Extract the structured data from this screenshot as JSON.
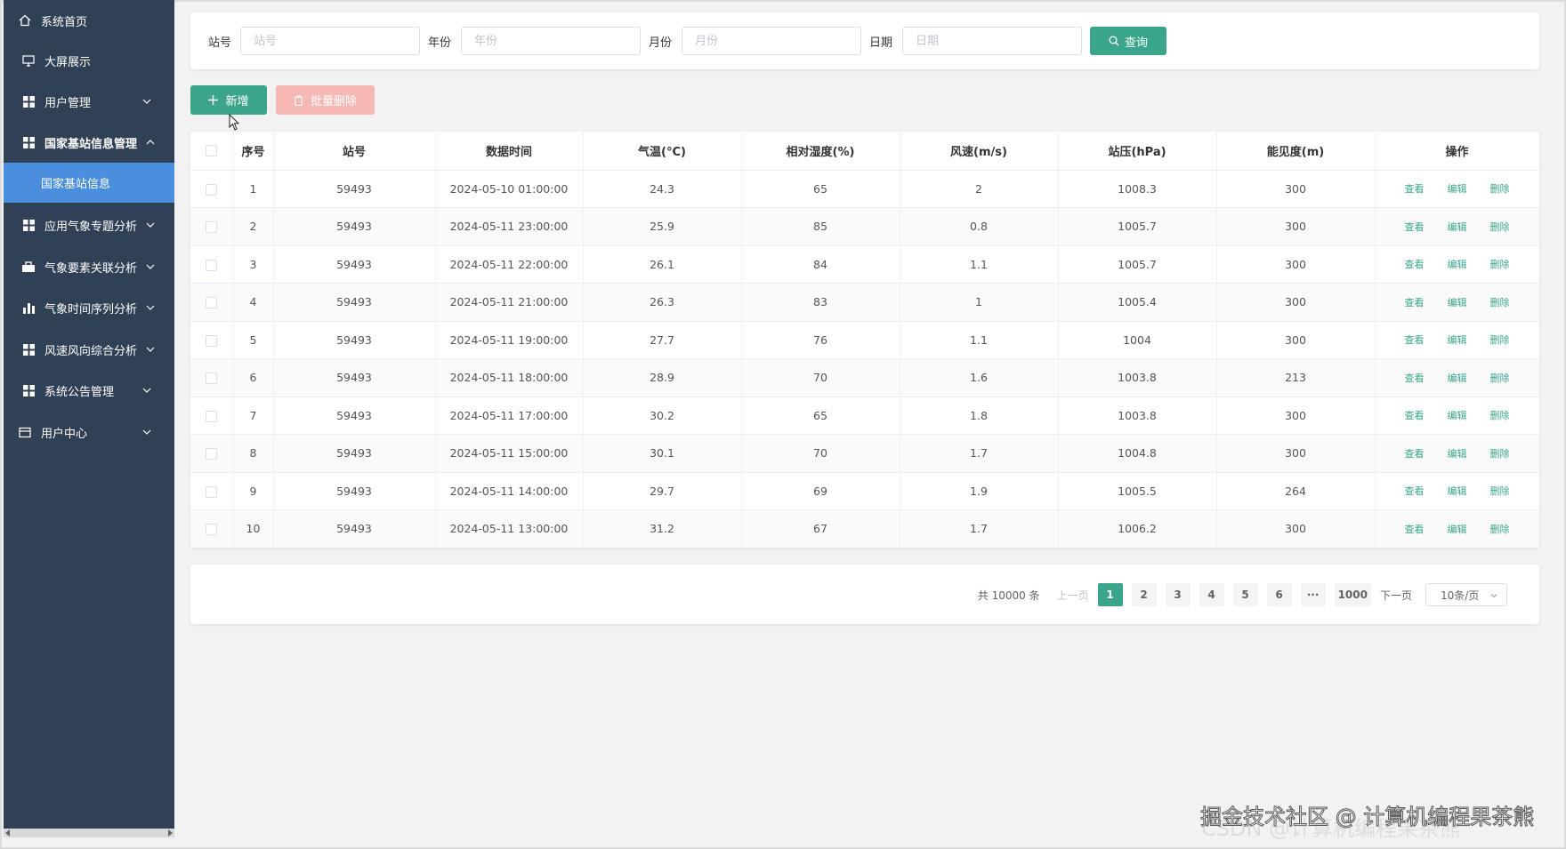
{
  "sidebar": {
    "items": [
      {
        "label": "系统首页",
        "icon": "home-icon"
      },
      {
        "label": "大屏展示",
        "icon": "monitor-icon"
      },
      {
        "label": "用户管理",
        "icon": "grid-icon"
      },
      {
        "label": "国家基站信息管理",
        "icon": "grid-icon"
      },
      {
        "label": "应用气象专题分析",
        "icon": "grid-icon"
      },
      {
        "label": "气象要素关联分析",
        "icon": "briefcase-icon"
      },
      {
        "label": "气象时间序列分析",
        "icon": "bar-chart-icon"
      },
      {
        "label": "风速风向综合分析",
        "icon": "grid-icon"
      },
      {
        "label": "系统公告管理",
        "icon": "grid-icon"
      },
      {
        "label": "用户中心",
        "icon": "card-icon"
      }
    ],
    "submenu_active": "国家基站信息"
  },
  "search": {
    "station_label": "站号",
    "station_placeholder": "站号",
    "year_label": "年份",
    "year_placeholder": "年份",
    "month_label": "月份",
    "month_placeholder": "月份",
    "date_label": "日期",
    "date_placeholder": "日期",
    "query_button": "查询"
  },
  "toolbar": {
    "add_label": "新增",
    "batch_delete_label": "批量删除"
  },
  "table": {
    "headers": [
      "序号",
      "站号",
      "数据时间",
      "气温(°C)",
      "相对湿度(%)",
      "风速(m/s)",
      "站压(hPa)",
      "能见度(m)",
      "操作"
    ],
    "actions": {
      "view": "查看",
      "edit": "编辑",
      "delete": "删除"
    },
    "rows": [
      [
        "1",
        "59493",
        "2024-05-10 01:00:00",
        "24.3",
        "65",
        "2",
        "1008.3",
        "300"
      ],
      [
        "2",
        "59493",
        "2024-05-11 23:00:00",
        "25.9",
        "85",
        "0.8",
        "1005.7",
        "300"
      ],
      [
        "3",
        "59493",
        "2024-05-11 22:00:00",
        "26.1",
        "84",
        "1.1",
        "1005.7",
        "300"
      ],
      [
        "4",
        "59493",
        "2024-05-11 21:00:00",
        "26.3",
        "83",
        "1",
        "1005.4",
        "300"
      ],
      [
        "5",
        "59493",
        "2024-05-11 19:00:00",
        "27.7",
        "76",
        "1.1",
        "1004",
        "300"
      ],
      [
        "6",
        "59493",
        "2024-05-11 18:00:00",
        "28.9",
        "70",
        "1.6",
        "1003.8",
        "213"
      ],
      [
        "7",
        "59493",
        "2024-05-11 17:00:00",
        "30.2",
        "65",
        "1.8",
        "1003.8",
        "300"
      ],
      [
        "8",
        "59493",
        "2024-05-11 15:00:00",
        "30.1",
        "70",
        "1.7",
        "1004.8",
        "300"
      ],
      [
        "9",
        "59493",
        "2024-05-11 14:00:00",
        "29.7",
        "69",
        "1.9",
        "1005.5",
        "264"
      ],
      [
        "10",
        "59493",
        "2024-05-11 13:00:00",
        "31.2",
        "67",
        "1.7",
        "1006.2",
        "300"
      ]
    ]
  },
  "pagination": {
    "total": "共 10000 条",
    "prev": "上一页",
    "pages": [
      "1",
      "2",
      "3",
      "4",
      "5",
      "6",
      "···",
      "1000"
    ],
    "current": "1",
    "next": "下一页",
    "page_size": "10条/页"
  },
  "watermark": "掘金技术社区 @ 计算机编程果茶熊",
  "watermark_faint": "CSDN @计算机编程果茶熊",
  "colors": {
    "sidebar_bg": "#304156",
    "active_submenu": "#4a8fde",
    "primary": "#3aa58a",
    "danger_disabled": "#f5b8b3"
  }
}
